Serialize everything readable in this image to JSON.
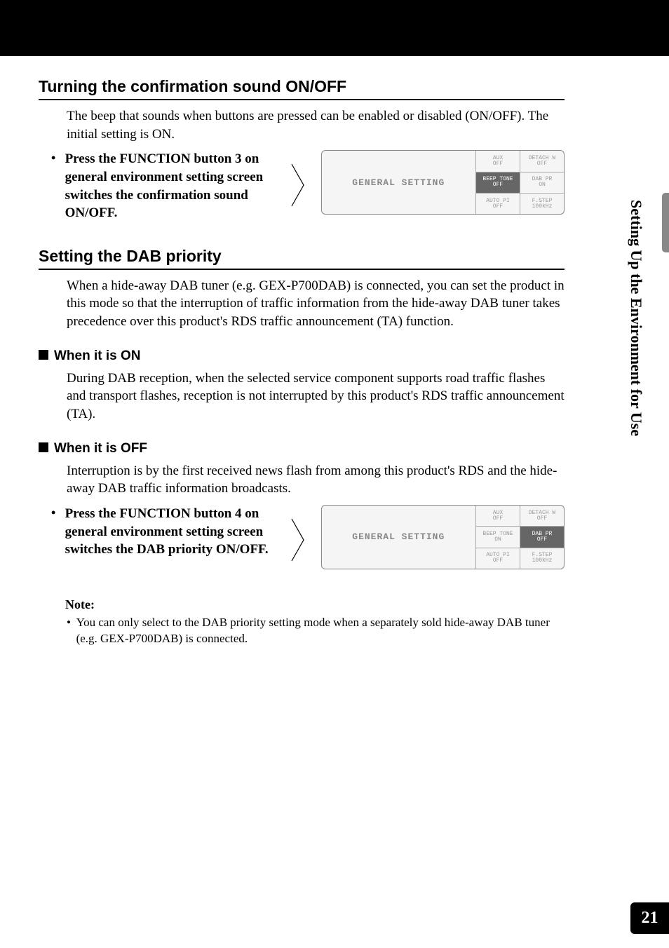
{
  "sideTab": "Setting Up the Environment for Use",
  "pageNumber": "21",
  "section1": {
    "title": "Turning the confirmation sound ON/OFF",
    "body": "The beep that sounds when buttons are pressed can be enabled or disabled (ON/OFF). The initial setting is ON.",
    "instruction": "Press the FUNCTION button 3 on general environment setting screen switches the confirmation sound ON/OFF."
  },
  "section2": {
    "title": "Setting the DAB priority",
    "body": "When a hide-away DAB tuner (e.g. GEX-P700DAB) is connected, you can set the product in this mode so that the interruption of traffic information from the hide-away DAB tuner takes precedence over this product's RDS traffic announcement (TA) function.",
    "subOn": {
      "title": "When it is ON",
      "body": "During DAB reception, when the selected service component supports road traffic flashes and transport flashes, reception is not interrupted by this product's RDS traffic announcement (TA)."
    },
    "subOff": {
      "title": "When it is OFF",
      "body": "Interruption is by the first received news flash from among this product's RDS and the hide-away DAB traffic information broadcasts."
    },
    "instruction": "Press the FUNCTION button 4 on general environment setting screen switches the DAB priority ON/OFF."
  },
  "note": {
    "label": "Note:",
    "text": "You can only select to the DAB priority setting mode when a separately sold hide-away DAB tuner (e.g. GEX-P700DAB) is connected."
  },
  "screen1": {
    "label": "GENERAL SETTING",
    "cells": [
      [
        {
          "t1": "AUX",
          "t2": "OFF",
          "hl": false
        },
        {
          "t1": "DETACH W",
          "t2": "OFF",
          "hl": false
        }
      ],
      [
        {
          "t1": "BEEP TONE",
          "t2": "OFF",
          "hl": true
        },
        {
          "t1": "DAB PR",
          "t2": "ON",
          "hl": false
        }
      ],
      [
        {
          "t1": "AUTO PI",
          "t2": "OFF",
          "hl": false
        },
        {
          "t1": "F.STEP",
          "t2": "100kHz",
          "hl": false
        }
      ]
    ]
  },
  "screen2": {
    "label": "GENERAL SETTING",
    "cells": [
      [
        {
          "t1": "AUX",
          "t2": "OFF",
          "hl": false
        },
        {
          "t1": "DETACH W",
          "t2": "OFF",
          "hl": false
        }
      ],
      [
        {
          "t1": "BEEP TONE",
          "t2": "ON",
          "hl": false
        },
        {
          "t1": "DAB PR",
          "t2": "OFF",
          "hl": true
        }
      ],
      [
        {
          "t1": "AUTO PI",
          "t2": "OFF",
          "hl": false
        },
        {
          "t1": "F.STEP",
          "t2": "100kHz",
          "hl": false
        }
      ]
    ]
  }
}
